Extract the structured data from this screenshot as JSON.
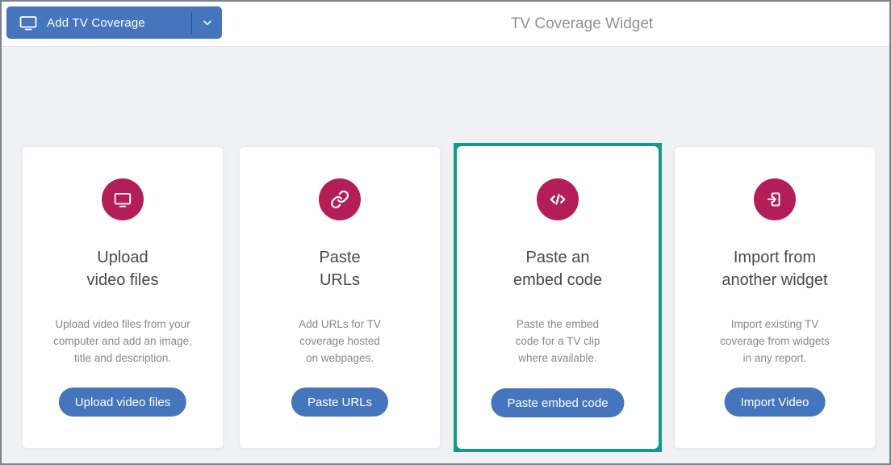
{
  "header": {
    "add_button": {
      "label": "Add TV Coverage",
      "icon": "tv-icon",
      "caret_icon": "chevron-down-icon"
    },
    "title": "TV Coverage Widget"
  },
  "colors": {
    "accent_blue": "#4576bd",
    "accent_crimson": "#b41e58",
    "highlight_teal": "#149a8c",
    "page_background": "#f0f1f4"
  },
  "cards": [
    {
      "icon": "monitor-icon",
      "title": "Upload\nvideo files",
      "description": "Upload video files from your\ncomputer and add an image,\ntitle and description.",
      "button_label": "Upload video files",
      "highlighted": false
    },
    {
      "icon": "link-icon",
      "title": "Paste\nURLs",
      "description": "Add URLs for TV\ncoverage hosted\non webpages.",
      "button_label": "Paste URLs",
      "highlighted": false
    },
    {
      "icon": "embed-code-icon",
      "title": "Paste an\nembed code",
      "description": "Paste the embed\ncode for a TV clip\nwhere available.",
      "button_label": "Paste embed code",
      "highlighted": true
    },
    {
      "icon": "import-icon",
      "title": "Import from\nanother widget",
      "description": "Import existing TV\ncoverage from widgets\nin any report.",
      "button_label": "Import Video",
      "highlighted": false
    }
  ]
}
